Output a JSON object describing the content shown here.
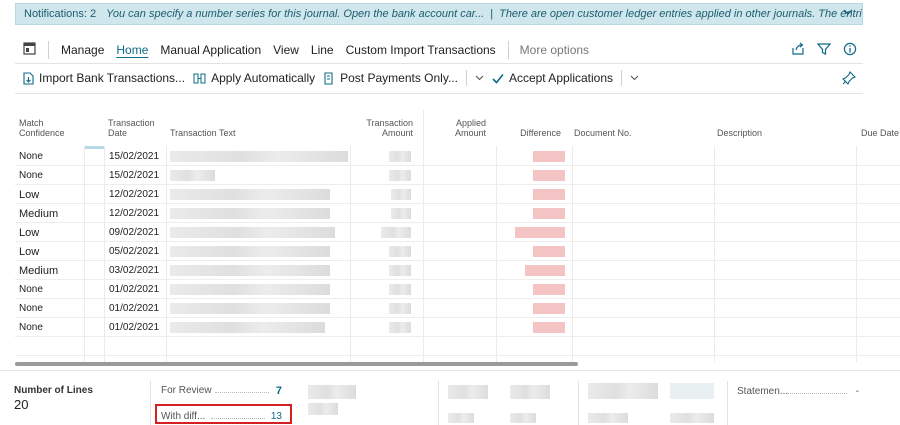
{
  "notification": {
    "count": "Notifications: 2",
    "msg1": "You can specify a number series for this journal. Open the bank account car...",
    "separator": "|",
    "msg2": "There are open customer ledger entries applied in other journals. The entries were not considered ..."
  },
  "actions": {
    "manage": "Manage",
    "home": "Home",
    "manual_application": "Manual Application",
    "view": "View",
    "line": "Line",
    "custom_import": "Custom Import Transactions",
    "more_options": "More options"
  },
  "toolbar": {
    "import": "Import Bank Transactions...",
    "apply_auto": "Apply Automatically",
    "post_payments": "Post Payments Only...",
    "accept": "Accept Applications"
  },
  "columns": {
    "match_confidence": "Match Confidence",
    "transaction_date": "Transaction Date",
    "transaction_text": "Transaction Text",
    "transaction_amount": "Transaction Amount",
    "applied_amount": "Applied Amount",
    "difference": "Difference",
    "document_no": "Document No.",
    "description": "Description",
    "due_date": "Due Date"
  },
  "rows": [
    {
      "conf": "None",
      "date": "15/02/2021"
    },
    {
      "conf": "None",
      "date": "15/02/2021"
    },
    {
      "conf": "Low",
      "date": "12/02/2021"
    },
    {
      "conf": "Medium",
      "date": "12/02/2021"
    },
    {
      "conf": "Low",
      "date": "09/02/2021"
    },
    {
      "conf": "Low",
      "date": "05/02/2021"
    },
    {
      "conf": "Medium",
      "date": "03/02/2021"
    },
    {
      "conf": "None",
      "date": "01/02/2021"
    },
    {
      "conf": "None",
      "date": "01/02/2021"
    },
    {
      "conf": "None",
      "date": "01/02/2021"
    }
  ],
  "footer": {
    "number_of_lines_label": "Number of Lines",
    "number_of_lines_value": "20",
    "for_review_label": "For Review",
    "for_review_value": "7",
    "with_diff_label": "With diff...",
    "with_diff_value": "13",
    "statement_label": "Statemen...",
    "statement_value": "-"
  }
}
